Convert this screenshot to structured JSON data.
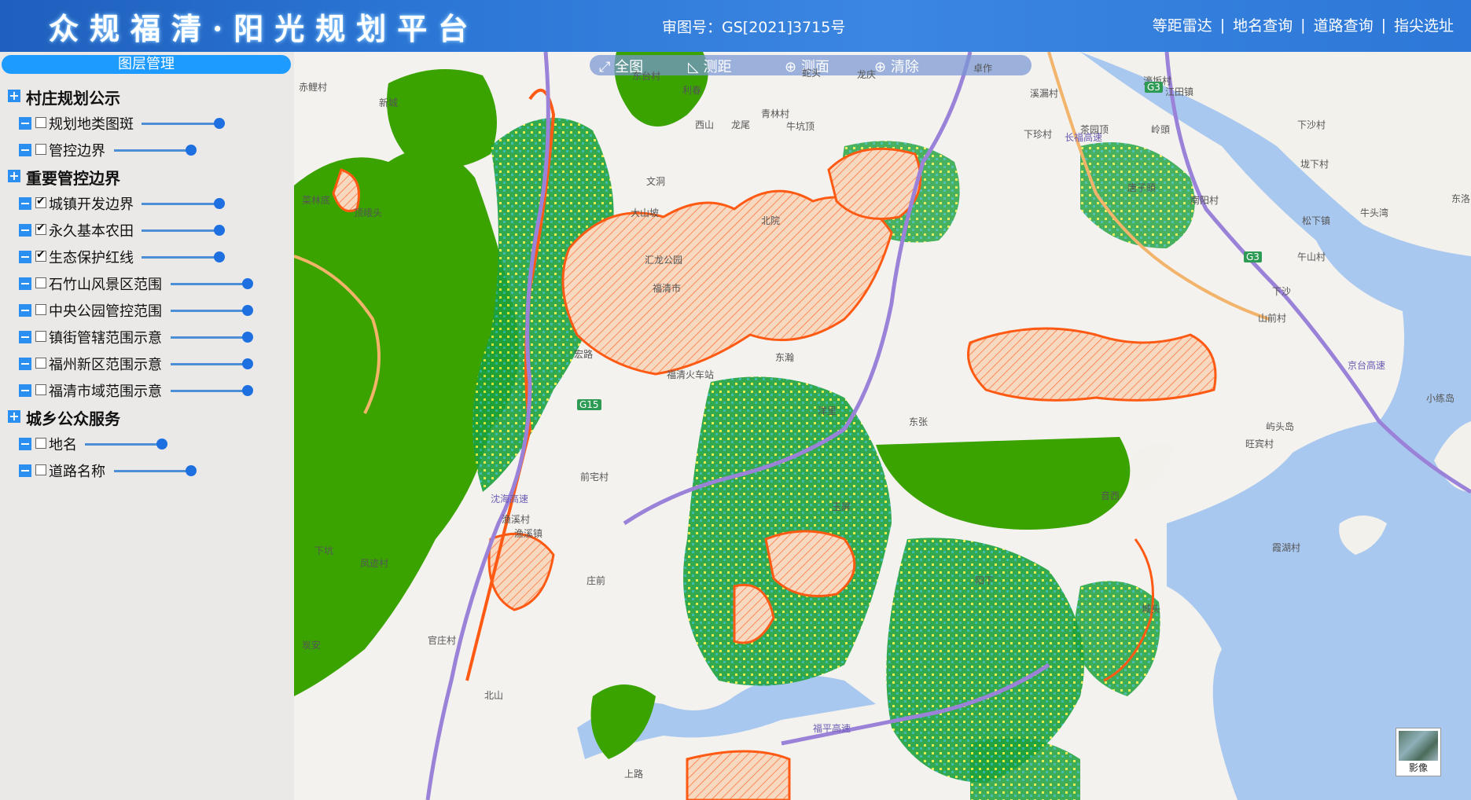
{
  "header": {
    "title": "众规福清·阳光规划平台",
    "approval": "审图号：GS[2021]3715号",
    "nav": [
      "等距雷达",
      "地名查询",
      "道路查询",
      "指尖选址"
    ],
    "nav_sep": "|"
  },
  "sidebar": {
    "panel_title": "图层管理",
    "group1": {
      "label": "村庄规划公示",
      "items": [
        {
          "label": "规划地类图斑",
          "checked": false
        },
        {
          "label": "管控边界",
          "checked": false
        }
      ]
    },
    "group2": {
      "label": "重要管控边界",
      "items": [
        {
          "label": "城镇开发边界",
          "checked": true
        },
        {
          "label": "永久基本农田",
          "checked": true
        },
        {
          "label": "生态保护红线",
          "checked": true
        },
        {
          "label": "石竹山风景区范围",
          "checked": false
        },
        {
          "label": "中央公园管控范围",
          "checked": false
        },
        {
          "label": "镇街管辖范围示意",
          "checked": false
        },
        {
          "label": "福州新区范围示意",
          "checked": false
        },
        {
          "label": "福清市域范围示意",
          "checked": false
        }
      ]
    },
    "group3": {
      "label": "城乡公众服务",
      "items": [
        {
          "label": "地名",
          "checked": false
        },
        {
          "label": "道路名称",
          "checked": false
        }
      ]
    }
  },
  "toolbar": {
    "full": "全图",
    "distance": "测距",
    "area": "测面",
    "clear": "清除",
    "icons": [
      "expand-icon",
      "ruler-icon",
      "zoom-area-icon",
      "zoom-clear-icon"
    ]
  },
  "map": {
    "imagery_label": "影像",
    "colors": {
      "ecology": "#3aa300",
      "farmland": "#19a23a",
      "urban_boundary": "#ff5a14",
      "water": "#a9c8ef",
      "highway": "#9b82d9"
    },
    "places": [
      "东台村",
      "利春",
      "青林村",
      "蛇头",
      "龙庆",
      "卓作",
      "溪漏村",
      "濠坂村",
      "江田镇",
      "下珍村",
      "茶园顶",
      "岭頭",
      "下沙村",
      "垅下村",
      "南阳村",
      "唐子頭",
      "东洛",
      "松下镇",
      "牛头湾",
      "午山村",
      "下沙",
      "山前村",
      "小练岛",
      "屿头岛",
      "旺宾村",
      "渔溪村",
      "霞湖村",
      "大山坡",
      "文洞",
      "西山",
      "龙尾",
      "牛坑顶",
      "顶峨头",
      "菜林底",
      "赤鲤村",
      "新城",
      "北山",
      "官庄村",
      "炭安",
      "下坑",
      "凤迹村",
      "上路",
      "前宅村",
      "汇龙公园",
      "福清市",
      "福清火车站",
      "北院",
      "庄前",
      "渔溪镇",
      "洋里",
      "东张",
      "宏路",
      "玉屏",
      "音西",
      "阳下",
      "城头",
      "东瀚"
    ],
    "road_shields": [
      "G3",
      "G3",
      "G15"
    ],
    "road_names": [
      "长福高速",
      "京台高速",
      "沈海高速",
      "福平高速"
    ]
  }
}
